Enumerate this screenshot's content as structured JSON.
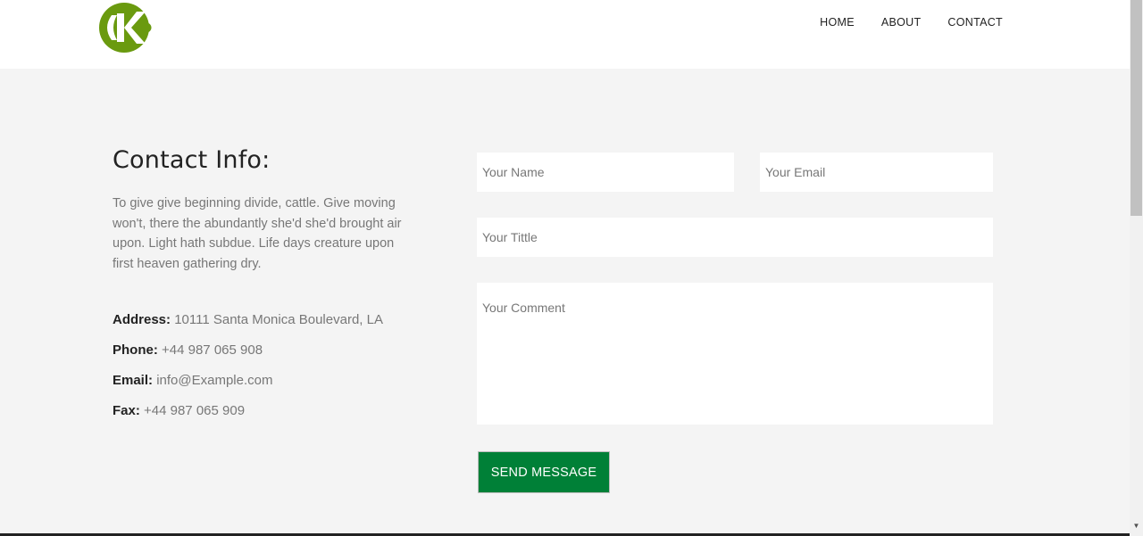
{
  "header": {
    "logo": {
      "icon": "ck-logo-icon",
      "color": "#6a9a0f"
    },
    "nav": [
      {
        "label": "HOME"
      },
      {
        "label": "ABOUT"
      },
      {
        "label": "CONTACT"
      }
    ]
  },
  "info": {
    "title": "Contact Info:",
    "description": "To give give beginning divide, cattle. Give moving won't, there the abundantly she'd she'd brought air upon. Light hath subdue. Life days creature upon first heaven gathering dry.",
    "address": {
      "label": "Address:",
      "value": "10111 Santa Monica Boulevard, LA"
    },
    "phone": {
      "label": "Phone:",
      "value": "+44 987 065 908"
    },
    "email": {
      "label": "Email:",
      "value": "info@Example.com"
    },
    "fax": {
      "label": "Fax:",
      "value": "+44 987 065 909"
    }
  },
  "form": {
    "name_placeholder": "Your Name",
    "email_placeholder": "Your Email",
    "title_placeholder": "Your Tittle",
    "comment_placeholder": "Your Comment",
    "send_label": "SEND MESSAGE",
    "send_color": "#008037"
  }
}
